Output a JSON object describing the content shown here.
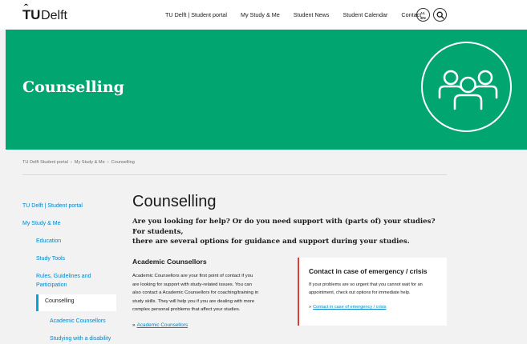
{
  "header": {
    "logo_tu": "TU",
    "logo_delft": "Delft",
    "nav": [
      "TU Delft | Student portal",
      "My Study & Me",
      "Student News",
      "Student Calendar",
      "Contact"
    ],
    "lang_top": "NL",
    "lang_bottom": "EN"
  },
  "hero": {
    "title": "Counselling",
    "icon": "people-group-icon",
    "color": "#00a56f"
  },
  "breadcrumb": [
    "TU Delft Student portal",
    "My Study & Me",
    "Counselling"
  ],
  "breadcrumb_sep": "›",
  "sidebar": {
    "items": [
      "TU Delft | Student portal",
      "My Study & Me",
      "Education",
      "Study Tools",
      "Rules, Guidelines and",
      "Participation"
    ],
    "active": "Counselling",
    "sub_items": [
      "Academic Counsellors",
      "Studying with a disability"
    ]
  },
  "main": {
    "title": "Counselling",
    "intro_line1": "Are you looking for help? Or do you need support with (parts of) your studies? For students,",
    "intro_line2": "there are several options for guidance and support during your studies.",
    "section": {
      "title": "Academic Counsellors",
      "lines": [
        "Academic Counsellors are your first point of contact if you",
        "are looking for support with study-related issues. You can",
        "also contact a Academic Counsellors for coaching/training in",
        "study skills. They will help you if you are dealing with more",
        "complex personal problems that affect your studies."
      ],
      "link_arrow": "»",
      "link": "Academic Counsellors"
    }
  },
  "card": {
    "title": "Contact in case of emergency / crisis",
    "line1": "If your problems are so urgent that you cannot wait for an",
    "line2": "appointment, check out options for immediate help.",
    "link_arrow": "»",
    "link": "Contact in case of emergency / crisis",
    "accent": "#e03c31"
  },
  "colors": {
    "link": "#0085c8",
    "active_bar": "#00a6d6",
    "background": "#f2f2f2"
  }
}
